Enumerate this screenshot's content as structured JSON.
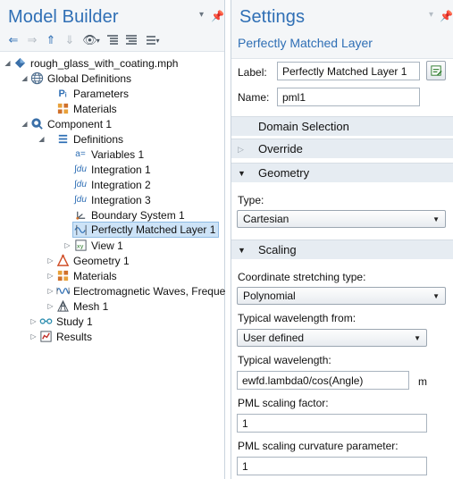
{
  "model_builder": {
    "title": "Model Builder",
    "toolbar": [
      "back-arrow",
      "forward-arrow",
      "move-up-arrow",
      "move-down-arrow",
      "show-menu",
      "expand-sections",
      "collapse-sections",
      "tree-options"
    ],
    "tree": {
      "root": "rough_glass_with_coating.mph",
      "global_definitions": "Global Definitions",
      "parameters": "Parameters",
      "global_materials": "Materials",
      "component": "Component 1",
      "definitions": "Definitions",
      "variables": "Variables 1",
      "integration1": "Integration 1",
      "integration2": "Integration 2",
      "integration3": "Integration 3",
      "boundary_system": "Boundary System 1",
      "pml": "Perfectly Matched Layer 1",
      "view": "View 1",
      "geometry": "Geometry 1",
      "materials": "Materials",
      "ewfd": "Electromagnetic Waves, Freque",
      "mesh": "Mesh 1",
      "study": "Study 1",
      "results": "Results"
    }
  },
  "settings": {
    "title": "Settings",
    "subtitle": "Perfectly Matched Layer",
    "label_caption": "Label:",
    "label_value": "Perfectly Matched Layer 1",
    "name_caption": "Name:",
    "name_value": "pml1",
    "sections": {
      "domain_selection": "Domain Selection",
      "override": "Override",
      "geometry": "Geometry",
      "scaling": "Scaling"
    },
    "type_label": "Type:",
    "type_value": "Cartesian",
    "stretch_label": "Coordinate stretching type:",
    "stretch_value": "Polynomial",
    "wavelength_from_label": "Typical wavelength from:",
    "wavelength_from_value": "User defined",
    "wavelength_label": "Typical wavelength:",
    "wavelength_value": "ewfd.lambda0/cos(Angle)",
    "wavelength_unit": "m",
    "scaling_factor_label": "PML scaling factor:",
    "scaling_factor_value": "1",
    "curvature_label": "PML scaling curvature parameter:",
    "curvature_value": "1"
  },
  "colors": {
    "accent": "#2f6fb5",
    "selection": "#cde3f7",
    "section_bg": "#e6ecf2"
  }
}
